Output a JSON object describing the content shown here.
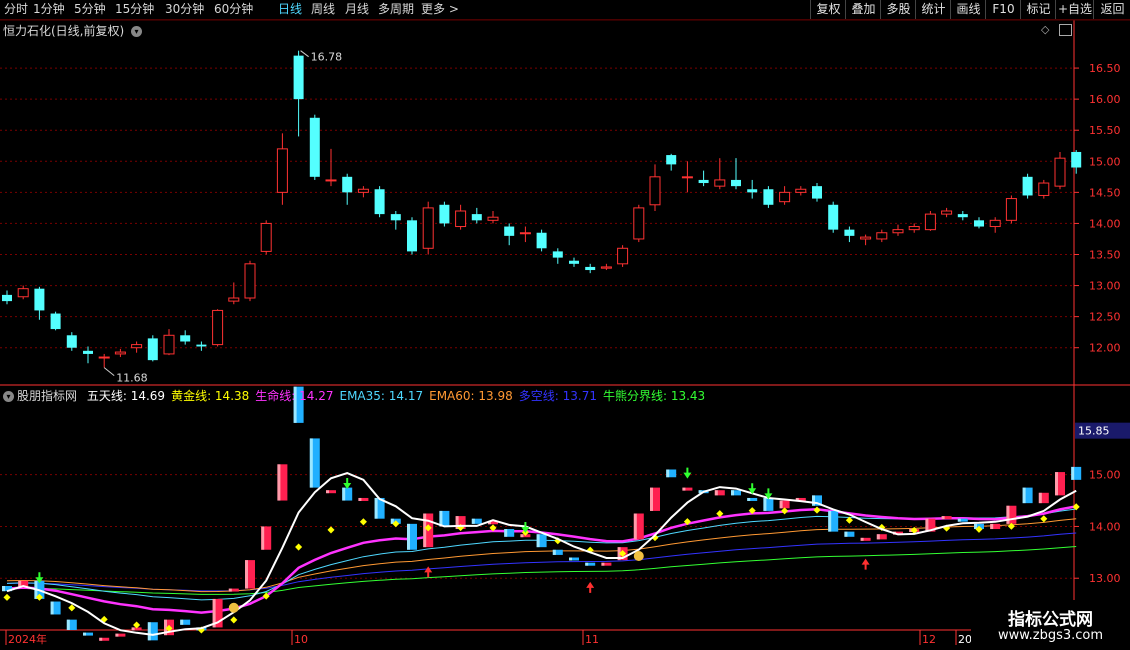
{
  "toolbar": {
    "periods": [
      "分时",
      "1分钟",
      "5分钟",
      "15分钟",
      "30分钟",
      "60分钟",
      "日线",
      "周线",
      "月线",
      "多周期",
      "更多 >"
    ],
    "active_period": "日线",
    "right_buttons": [
      "复权",
      "叠加",
      "多股",
      "统计",
      "画线",
      "F10",
      "标记",
      "+自选",
      "返回"
    ]
  },
  "main_chart": {
    "title": "恒力石化(日线,前复权)",
    "high_label": "16.78",
    "low_label": "11.68",
    "y_ticks": [
      "16.50",
      "16.00",
      "15.50",
      "15.00",
      "14.50",
      "14.00",
      "13.50",
      "13.00",
      "12.50",
      "12.00"
    ],
    "y_values": [
      16.5,
      16.0,
      15.5,
      15.0,
      14.5,
      14.0,
      13.5,
      13.0,
      12.5,
      12.0
    ],
    "ylim": [
      11.4,
      17.0
    ],
    "colors": {
      "up": "#ff3232",
      "down": "#54ffff",
      "grid": "#7a0000",
      "axis": "#ff3232"
    }
  },
  "indicator": {
    "name": "股朋指标网",
    "items": [
      {
        "label": "五天线: ",
        "value": "14.69",
        "color": "#ffffff"
      },
      {
        "label": "黄金线: ",
        "value": "14.38",
        "color": "#ffff00"
      },
      {
        "label": "生命线: ",
        "value": "14.27",
        "color": "#ff33ff"
      },
      {
        "label": "EMA35: ",
        "value": "14.17",
        "color": "#4fd8ff"
      },
      {
        "label": "EMA60: ",
        "value": "13.98",
        "color": "#ff9933"
      },
      {
        "label": "多空线: ",
        "value": "13.71",
        "color": "#3333ff"
      },
      {
        "label": "牛熊分界线: ",
        "value": "13.43",
        "color": "#33ff33"
      }
    ],
    "y_ticks": [
      "15.00",
      "14.00",
      "13.00"
    ],
    "y_values": [
      15.0,
      14.0,
      13.0
    ],
    "ylim": [
      12.0,
      16.5
    ],
    "current_price": "15.85"
  },
  "x_axis": {
    "labels": [
      "2024年",
      "10",
      "11",
      "12",
      "20"
    ]
  },
  "candles": [
    [
      12.85,
      12.75,
      12.92,
      12.7
    ],
    [
      12.82,
      12.95,
      13.0,
      12.78
    ],
    [
      12.95,
      12.6,
      12.98,
      12.45
    ],
    [
      12.55,
      12.3,
      12.58,
      12.28
    ],
    [
      12.2,
      12.0,
      12.25,
      11.95
    ],
    [
      11.95,
      11.9,
      12.02,
      11.75
    ],
    [
      11.85,
      11.85,
      11.9,
      11.68
    ],
    [
      11.9,
      11.93,
      11.98,
      11.85
    ],
    [
      12.0,
      12.05,
      12.1,
      11.92
    ],
    [
      12.15,
      11.8,
      12.2,
      11.78
    ],
    [
      11.9,
      12.2,
      12.3,
      11.88
    ],
    [
      12.2,
      12.1,
      12.28,
      12.05
    ],
    [
      12.05,
      12.02,
      12.1,
      11.95
    ],
    [
      12.05,
      12.6,
      12.62,
      12.02
    ],
    [
      12.75,
      12.8,
      13.05,
      12.7
    ],
    [
      12.8,
      13.35,
      13.4,
      12.75
    ],
    [
      13.55,
      14.0,
      14.05,
      13.5
    ],
    [
      14.5,
      15.2,
      15.45,
      14.3
    ],
    [
      16.7,
      16.0,
      16.78,
      15.4
    ],
    [
      15.7,
      14.75,
      15.75,
      14.7
    ],
    [
      14.7,
      14.7,
      15.2,
      14.6
    ],
    [
      14.75,
      14.5,
      14.8,
      14.3
    ],
    [
      14.5,
      14.55,
      14.6,
      14.42
    ],
    [
      14.55,
      14.15,
      14.6,
      14.1
    ],
    [
      14.15,
      14.05,
      14.2,
      13.9
    ],
    [
      14.05,
      13.55,
      14.1,
      13.5
    ],
    [
      13.6,
      14.25,
      14.35,
      13.5
    ],
    [
      14.3,
      14.0,
      14.35,
      13.95
    ],
    [
      13.95,
      14.2,
      14.3,
      13.9
    ],
    [
      14.15,
      14.05,
      14.25,
      14.0
    ],
    [
      14.05,
      14.1,
      14.2,
      14.0
    ],
    [
      13.95,
      13.8,
      14.0,
      13.65
    ],
    [
      13.85,
      13.85,
      13.95,
      13.7
    ],
    [
      13.85,
      13.6,
      13.9,
      13.55
    ],
    [
      13.55,
      13.45,
      13.6,
      13.35
    ],
    [
      13.4,
      13.35,
      13.45,
      13.3
    ],
    [
      13.3,
      13.25,
      13.35,
      13.2
    ],
    [
      13.28,
      13.3,
      13.35,
      13.25
    ],
    [
      13.35,
      13.6,
      13.65,
      13.3
    ],
    [
      13.75,
      14.25,
      14.3,
      13.7
    ],
    [
      14.3,
      14.75,
      14.95,
      14.2
    ],
    [
      15.1,
      14.95,
      15.12,
      14.85
    ],
    [
      14.75,
      14.75,
      15.0,
      14.5
    ],
    [
      14.7,
      14.65,
      14.85,
      14.6
    ],
    [
      14.6,
      14.7,
      15.05,
      14.55
    ],
    [
      14.7,
      14.6,
      15.05,
      14.55
    ],
    [
      14.55,
      14.5,
      14.7,
      14.4
    ],
    [
      14.55,
      14.3,
      14.6,
      14.25
    ],
    [
      14.35,
      14.5,
      14.6,
      14.3
    ],
    [
      14.5,
      14.55,
      14.6,
      14.45
    ],
    [
      14.6,
      14.4,
      14.65,
      14.35
    ],
    [
      14.3,
      13.9,
      14.35,
      13.85
    ],
    [
      13.9,
      13.8,
      13.95,
      13.7
    ],
    [
      13.75,
      13.78,
      13.82,
      13.65
    ],
    [
      13.75,
      13.85,
      13.9,
      13.7
    ],
    [
      13.85,
      13.9,
      13.98,
      13.8
    ],
    [
      13.9,
      13.95,
      14.0,
      13.85
    ],
    [
      13.9,
      14.15,
      14.2,
      13.88
    ],
    [
      14.15,
      14.2,
      14.25,
      14.1
    ],
    [
      14.15,
      14.1,
      14.2,
      14.05
    ],
    [
      14.05,
      13.95,
      14.1,
      13.92
    ],
    [
      13.95,
      14.05,
      14.1,
      13.85
    ],
    [
      14.05,
      14.4,
      14.45,
      14.0
    ],
    [
      14.75,
      14.45,
      14.8,
      14.4
    ],
    [
      14.45,
      14.65,
      14.7,
      14.4
    ],
    [
      14.6,
      15.05,
      15.15,
      14.55
    ],
    [
      15.15,
      14.9,
      15.18,
      14.8
    ]
  ]
}
